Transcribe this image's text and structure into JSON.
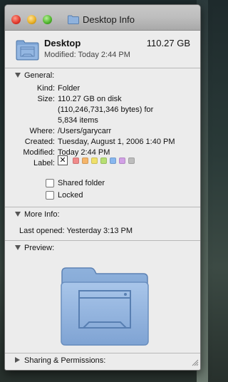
{
  "window": {
    "title": "Desktop Info"
  },
  "header": {
    "name": "Desktop",
    "size": "110.27 GB",
    "modified": "Modified: Today 2:44 PM"
  },
  "general": {
    "heading": "General:",
    "rows": [
      {
        "key": "Kind:",
        "value": "Folder"
      },
      {
        "key": "Size:",
        "value": "110.27 GB on disk"
      },
      {
        "key": "",
        "value": "(110,246,731,346 bytes) for"
      },
      {
        "key": "",
        "value": "5,834 items"
      },
      {
        "key": "Where:",
        "value": "/Users/garycarr"
      },
      {
        "key": "Created:",
        "value": "Tuesday, August 1, 2006 1:40 PM"
      },
      {
        "key": "Modified:",
        "value": "Today 2:44 PM"
      }
    ],
    "label_key": "Label:",
    "label_none": "✕",
    "label_colors": [
      "#f08a8a",
      "#f5b56a",
      "#efe06a",
      "#b6df72",
      "#88b7ef",
      "#d2a0e6",
      "#bdbdbd"
    ],
    "shared_folder": "Shared folder",
    "locked": "Locked"
  },
  "more_info": {
    "heading": "More Info:",
    "last_opened": "Last opened: Yesterday 3:13 PM"
  },
  "preview": {
    "heading": "Preview:"
  },
  "sharing": {
    "heading": "Sharing & Permissions:"
  },
  "icons": {
    "title_icon": "folder-icon",
    "header_icon": "desktop-folder-icon",
    "preview_icon": "desktop-folder-icon",
    "disclosure_open": "triangle-down-icon",
    "disclosure_closed": "triangle-right-icon",
    "resize": "resize-grip-icon"
  }
}
